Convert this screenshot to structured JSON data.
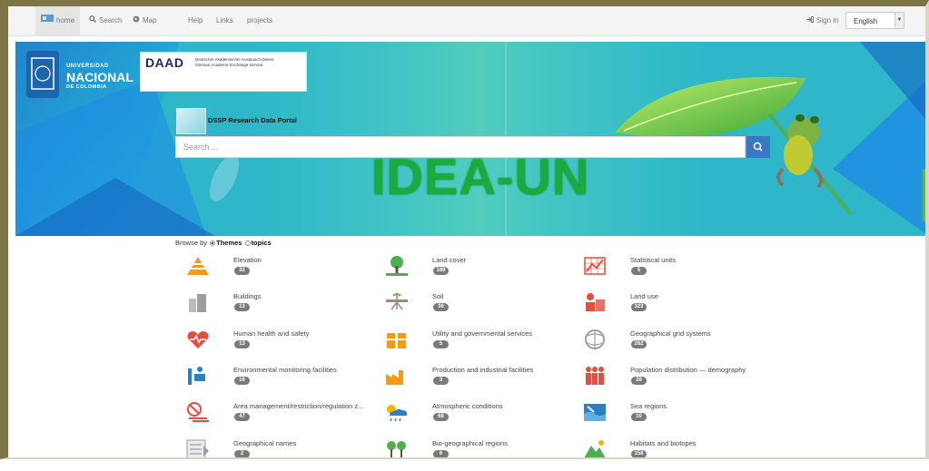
{
  "navbar": {
    "home": "home",
    "search": "Search",
    "map": "Map",
    "help": "Help",
    "links": "Links",
    "projects": "projects",
    "sign_in": "Sign in",
    "language": "English"
  },
  "banner": {
    "university_line1": "UNIVERSIDAD",
    "university_line2": "NACIONAL",
    "university_line3": "DE COLOMBIA",
    "daad_logo": "DAAD",
    "daad_line1": "Deutscher Akademischer Austausch Dienst",
    "daad_line2": "German Academic Exchange Service",
    "portal_title": "DSSP Research Data Portal",
    "search_placeholder": "Search ...",
    "big_title": "IDEA-UN"
  },
  "browse": {
    "prefix": "Browse by",
    "option_themes": "Themes",
    "option_topics": "topics",
    "selected": "Themes"
  },
  "themes": [
    {
      "label": "Elevation",
      "count": "32",
      "icon": "elevation-icon",
      "color": "#f39c12"
    },
    {
      "label": "Land cover",
      "count": "189",
      "icon": "land-cover-icon",
      "color": "#4caf50"
    },
    {
      "label": "Statistical units",
      "count": "5",
      "icon": "statistical-units-icon",
      "color": "#e74c3c"
    },
    {
      "label": "Buildings",
      "count": "13",
      "icon": "buildings-icon",
      "color": "#9e9e9e"
    },
    {
      "label": "Soil",
      "count": "36",
      "icon": "soil-icon",
      "color": "#a1887f"
    },
    {
      "label": "Land use",
      "count": "323",
      "icon": "land-use-icon",
      "color": "#e74c3c"
    },
    {
      "label": "Human health and safety",
      "count": "13",
      "icon": "health-icon",
      "color": "#e74c3c"
    },
    {
      "label": "Utility and governmental services",
      "count": "5",
      "icon": "utility-icon",
      "color": "#f39c12"
    },
    {
      "label": "Geographical grid systems",
      "count": "262",
      "icon": "grid-systems-icon",
      "color": "#9e9e9e"
    },
    {
      "label": "Environmental monitoring facilities",
      "count": "16",
      "icon": "monitoring-icon",
      "color": "#2a7fc9"
    },
    {
      "label": "Production and industrial facilities",
      "count": "3",
      "icon": "industry-icon",
      "color": "#f39c12"
    },
    {
      "label": "Population distribution — demography",
      "count": "28",
      "icon": "population-icon",
      "color": "#e74c3c"
    },
    {
      "label": "Area management/restriction/regulation z...",
      "count": "47",
      "icon": "area-management-icon",
      "color": "#e74c3c"
    },
    {
      "label": "Atmospheric conditions",
      "count": "68",
      "icon": "atmospheric-icon",
      "color": "#2a7fc9"
    },
    {
      "label": "Sea regions",
      "count": "10",
      "icon": "sea-regions-icon",
      "color": "#2a7fc9"
    },
    {
      "label": "Geographical names",
      "count": "2",
      "icon": "geographical-names-icon",
      "color": "#9e9e9e"
    },
    {
      "label": "Bio-geographical regions",
      "count": "6",
      "icon": "bio-regions-icon",
      "color": "#4caf50"
    },
    {
      "label": "Habitats and biotopes",
      "count": "158",
      "icon": "habitats-icon",
      "color": "#4caf50"
    }
  ]
}
